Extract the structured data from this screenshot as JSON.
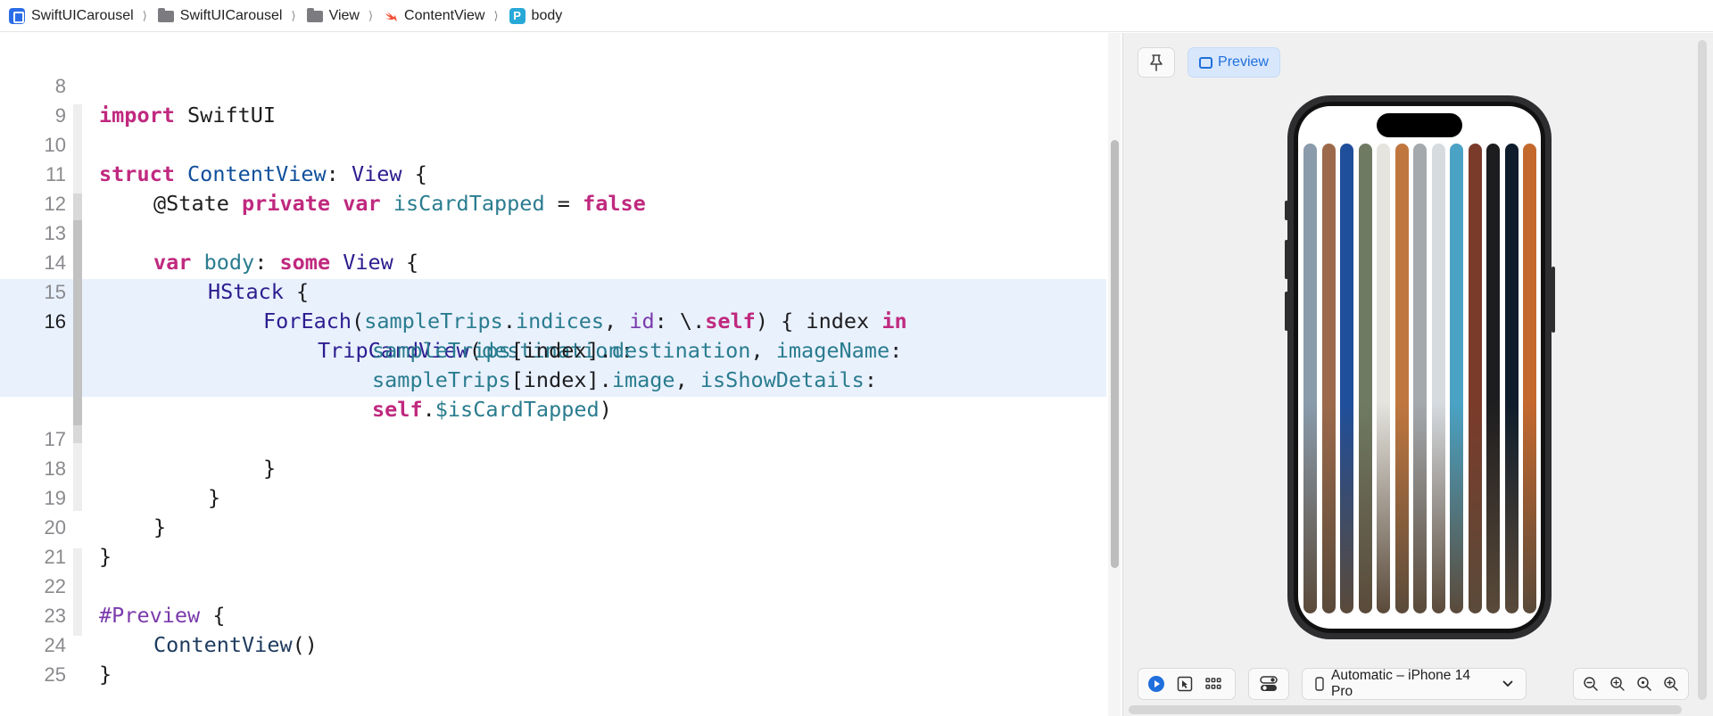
{
  "breadcrumb": {
    "items": [
      {
        "label": "SwiftUICarousel",
        "icon": "app-icon"
      },
      {
        "label": "SwiftUICarousel",
        "icon": "folder-icon"
      },
      {
        "label": "View",
        "icon": "folder-icon"
      },
      {
        "label": "ContentView",
        "icon": "swift-file-icon"
      },
      {
        "label": "body",
        "icon": "property-icon",
        "icon_glyph": "P"
      }
    ],
    "separator": "⟩"
  },
  "editor": {
    "active_line": 16,
    "line_numbers": [
      "8",
      "9",
      "10",
      "11",
      "12",
      "13",
      "14",
      "15",
      "16",
      "17",
      "18",
      "19",
      "20",
      "21",
      "22",
      "23",
      "24",
      "25"
    ],
    "code": {
      "l8": {
        "kw": "import",
        "rest": " SwiftUI"
      },
      "l10": {
        "kw": "struct",
        "name": " ContentView",
        "colon": ": ",
        "type": "View",
        "brace": " {"
      },
      "l11": {
        "attr": "@State",
        "kw1": " private",
        "kw2": " var",
        "name": " isCardTapped",
        "eq": " = ",
        "val": "false"
      },
      "l13": {
        "kw1": "var",
        "name": " body",
        "colon": ": ",
        "kw2": "some",
        "type": " View",
        "brace": " {"
      },
      "l14": {
        "call": "HStack",
        "brace": " {"
      },
      "l15": {
        "call": "ForEach",
        "p1": "(",
        "a1": "sampleTrips",
        "dot": ".",
        "a2": "indices",
        "comma": ", ",
        "a3": "id",
        "p2": ": \\.",
        "a4": "self",
        "p3": ") { index ",
        "kw": "in"
      },
      "l16a": {
        "call": "TripCardView",
        "p1": "(",
        "a1": "destination",
        "p2": ":"
      },
      "l16b": {
        "a1": "sampleTrips",
        "p1": "[index].",
        "a2": "destination",
        "p2": ", ",
        "a3": "imageName",
        "p3": ":"
      },
      "l16c": {
        "a1": "sampleTrips",
        "p1": "[index].",
        "a2": "image",
        "p2": ", ",
        "a3": "isShowDetails",
        "p3": ":"
      },
      "l16d": {
        "kw": "self",
        "p1": ".",
        "a1": "$isCardTapped",
        "p2": ")"
      },
      "l17": {
        "text": "}"
      },
      "l18": {
        "text": "}"
      },
      "l19": {
        "text": "}"
      },
      "l20": {
        "text": "}"
      },
      "l22": {
        "macro": "#Preview",
        "brace": " {"
      },
      "l23": {
        "call": "ContentView",
        "p": "()"
      },
      "l24": {
        "text": "}"
      }
    }
  },
  "canvas": {
    "preview_label": "Preview",
    "device_label": "Automatic – iPhone 14 Pro",
    "accent_color": "#1f6fdc",
    "zoom_icons": [
      "zoom-out-icon",
      "zoom-fit-icon",
      "zoom-actual-icon",
      "zoom-in-icon"
    ],
    "card_strip_colors": [
      "#8a9bab",
      "#9c6a4b",
      "#1f4e9b",
      "#6f7a63",
      "#e5e4df",
      "#c0773f",
      "#a4a9ae",
      "#d6dbe0",
      "#4aa3c5",
      "#7b3b2a",
      "#1d1d1f",
      "#0e1c2b",
      "#c4692e"
    ]
  }
}
